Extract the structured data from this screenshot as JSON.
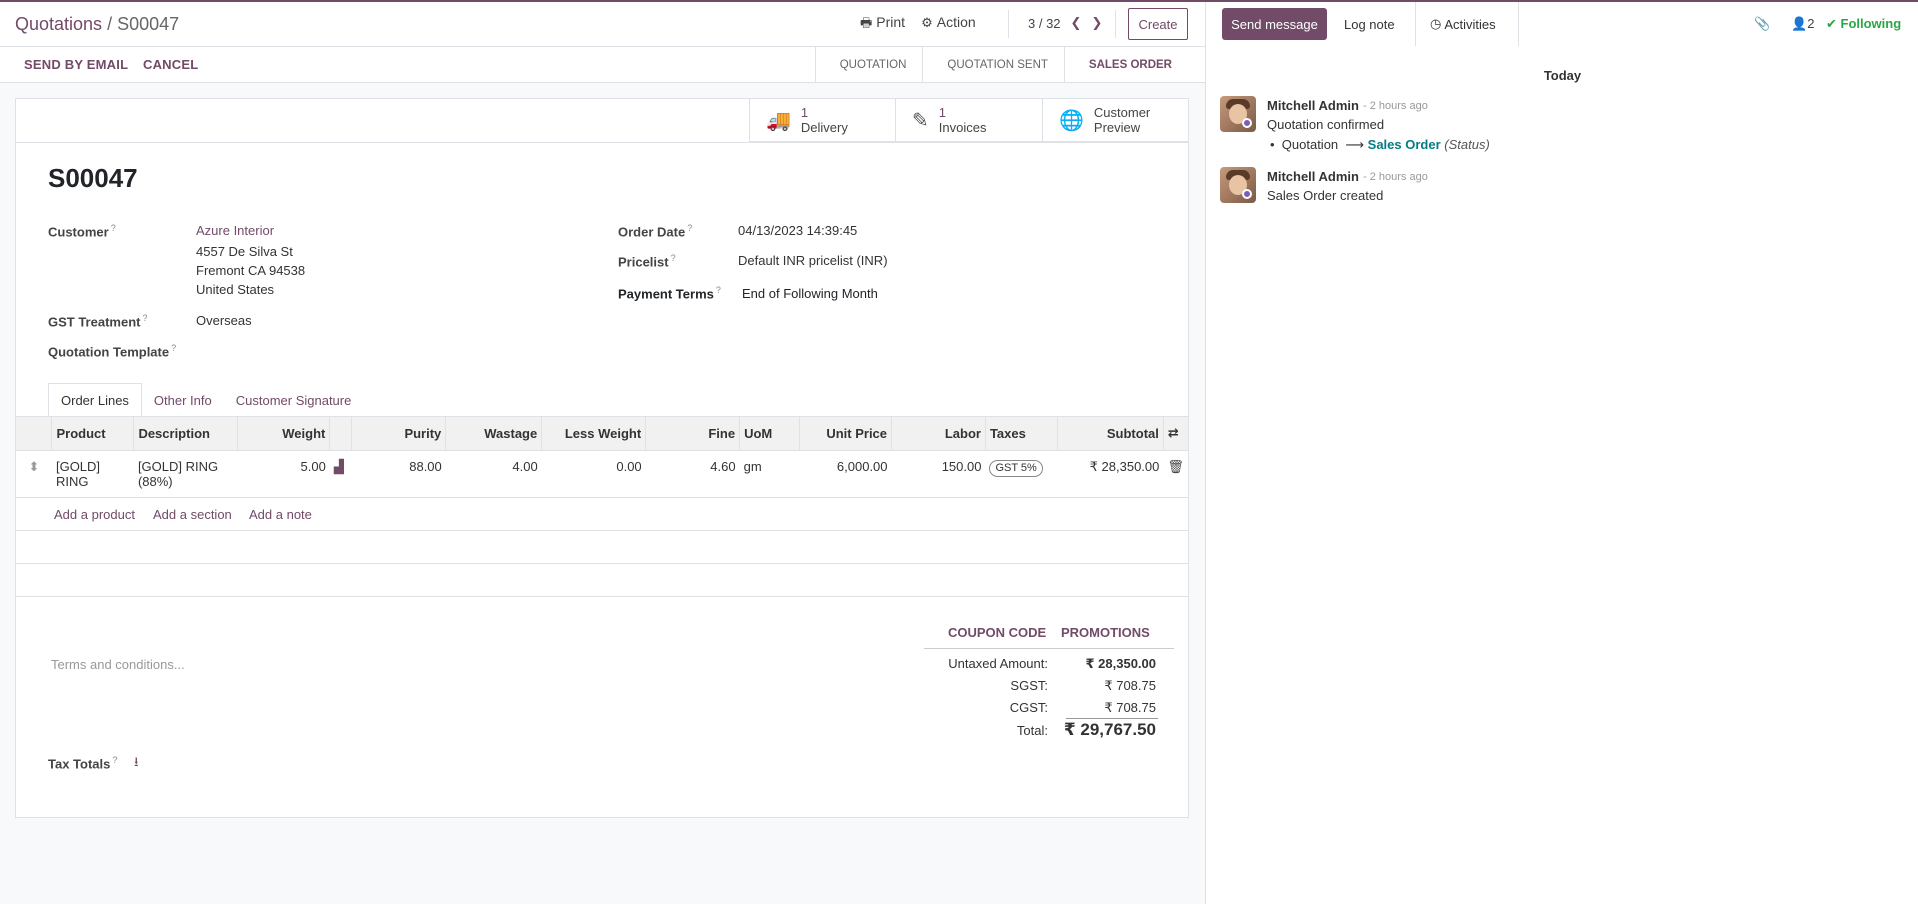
{
  "breadcrumb": {
    "parent": "Quotations",
    "separator": " / ",
    "current": "S00047"
  },
  "toolbar": {
    "print": "Print",
    "action": "Action",
    "pager": "3 / 32",
    "create": "Create"
  },
  "statusbar": {
    "buttons": [
      "SEND BY EMAIL",
      "CANCEL"
    ],
    "stages": [
      "QUOTATION",
      "QUOTATION SENT",
      "SALES ORDER"
    ],
    "active_stage": "SALES ORDER"
  },
  "smart_buttons": [
    {
      "count": "1",
      "label": "Delivery",
      "icon": "truck-icon"
    },
    {
      "count": "1",
      "label": "Invoices",
      "icon": "edit-icon"
    },
    {
      "count": "Customer",
      "label": "Preview",
      "icon": "globe-icon"
    }
  ],
  "record": {
    "name": "S00047",
    "customer_label": "Customer",
    "customer_name": "Azure Interior",
    "address": [
      "4557 De Silva St",
      "Fremont CA 94538",
      "United States"
    ],
    "gst_label": "GST Treatment",
    "gst_value": "Overseas",
    "template_label": "Quotation Template",
    "order_date_label": "Order Date",
    "order_date": "04/13/2023 14:39:45",
    "pricelist_label": "Pricelist",
    "pricelist": "Default INR pricelist (INR)",
    "payment_terms_label": "Payment Terms",
    "payment_terms": "End of Following Month"
  },
  "tabs": [
    "Order Lines",
    "Other Info",
    "Customer Signature"
  ],
  "lines": {
    "columns": [
      "Product",
      "Description",
      "Weight",
      "Purity",
      "Wastage",
      "Less Weight",
      "Fine",
      "UoM",
      "Unit Price",
      "Labor",
      "Taxes",
      "Subtotal"
    ],
    "rows": [
      {
        "product": "[GOLD] RING",
        "description": "[GOLD] RING (88%)",
        "weight": "5.00",
        "purity": "88.00",
        "wastage": "4.00",
        "less_weight": "0.00",
        "fine": "4.60",
        "uom": "gm",
        "unit_price": "6,000.00",
        "labor": "150.00",
        "taxes": "GST 5%",
        "subtotal": "₹ 28,350.00"
      }
    ],
    "add_links": [
      "Add a product",
      "Add a section",
      "Add a note"
    ]
  },
  "footer": {
    "terms_placeholder": "Terms and conditions...",
    "coupon": "COUPON CODE",
    "promotions": "PROMOTIONS",
    "totals": [
      {
        "label": "Untaxed Amount:",
        "value": "₹ 28,350.00"
      },
      {
        "label": "SGST:",
        "value": "₹ 708.75"
      },
      {
        "label": "CGST:",
        "value": "₹ 708.75"
      },
      {
        "label": "Total:",
        "value": "₹ 29,767.50"
      }
    ],
    "tax_totals_label": "Tax Totals"
  },
  "chatter": {
    "send_message": "Send message",
    "log_note": "Log note",
    "activities": "Activities",
    "followers_count": "2",
    "following": "Following",
    "date_separator": "Today",
    "messages": [
      {
        "author": "Mitchell Admin",
        "time": "- 2 hours ago",
        "body": "Quotation confirmed",
        "tracking_from": "Quotation",
        "tracking_to": "Sales Order",
        "tracking_field": "(Status)"
      },
      {
        "author": "Mitchell Admin",
        "time": "- 2 hours ago",
        "body": "Sales Order created"
      }
    ]
  },
  "colors": {
    "brand": "#714b67",
    "following": "#28a745",
    "link": "#017e84"
  }
}
